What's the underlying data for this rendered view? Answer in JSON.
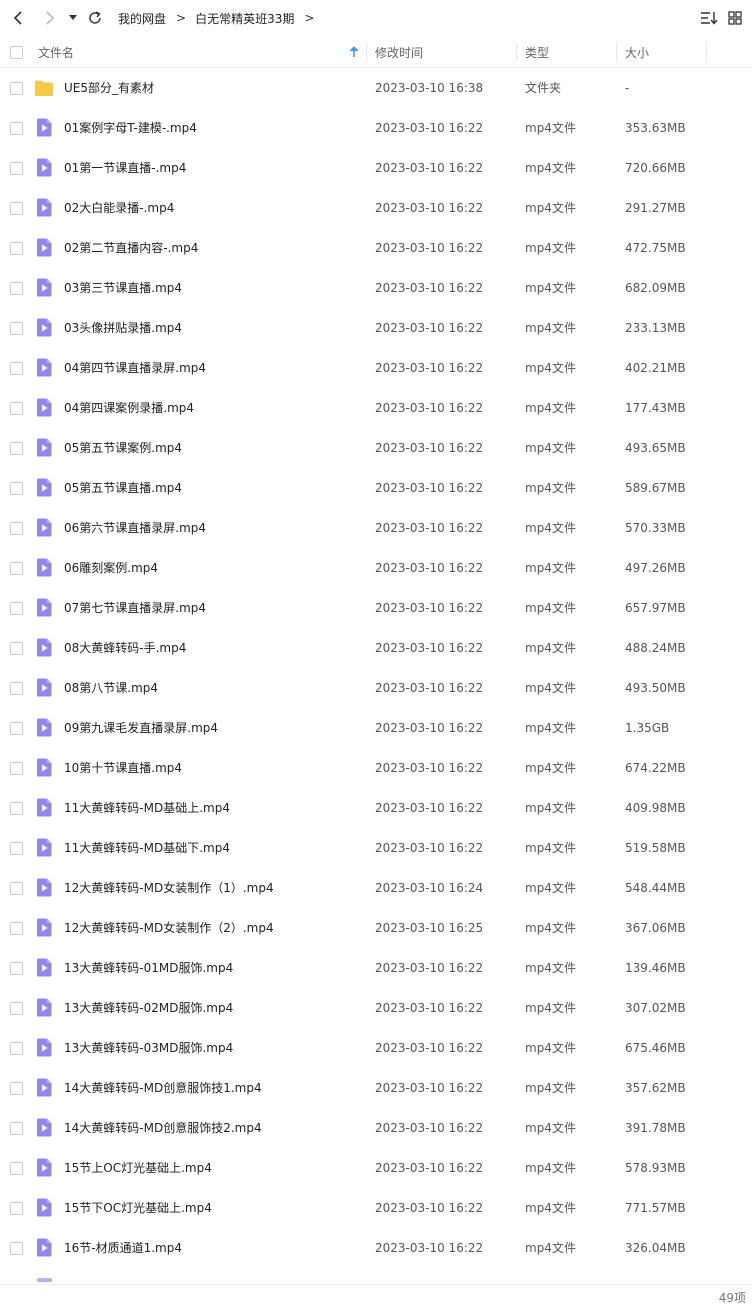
{
  "toolbar": {
    "back_icon": "chevron-left-icon",
    "forward_icon": "chevron-right-icon",
    "history_icon": "caret-down-icon",
    "refresh_icon": "refresh-icon",
    "breadcrumb": [
      "我的网盘",
      "白无常精英班33期"
    ],
    "separator": ">",
    "sort_icon": "sort-list-icon",
    "view_icon": "grid-view-icon"
  },
  "header": {
    "name": "文件名",
    "modified": "修改时间",
    "type": "类型",
    "size": "大小",
    "sort_icon": "arrow-up-icon"
  },
  "colors": {
    "folder": "#f7c948",
    "video": "#8f86ef",
    "sort_arrow": "#3a9ce8"
  },
  "files": [
    {
      "name": "UE5部分_有素材",
      "time": "2023-03-10 16:38",
      "type": "文件夹",
      "size": "-",
      "icon": "folder-icon"
    },
    {
      "name": "01案例字母T-建模-.mp4",
      "time": "2023-03-10 16:22",
      "type": "mp4文件",
      "size": "353.63MB",
      "icon": "video-file-icon"
    },
    {
      "name": "01第一节课直播-.mp4",
      "time": "2023-03-10 16:22",
      "type": "mp4文件",
      "size": "720.66MB",
      "icon": "video-file-icon"
    },
    {
      "name": "02大白能录播-.mp4",
      "time": "2023-03-10 16:22",
      "type": "mp4文件",
      "size": "291.27MB",
      "icon": "video-file-icon"
    },
    {
      "name": "02第二节直播内容-.mp4",
      "time": "2023-03-10 16:22",
      "type": "mp4文件",
      "size": "472.75MB",
      "icon": "video-file-icon"
    },
    {
      "name": "03第三节课直播.mp4",
      "time": "2023-03-10 16:22",
      "type": "mp4文件",
      "size": "682.09MB",
      "icon": "video-file-icon"
    },
    {
      "name": "03头像拼贴录播.mp4",
      "time": "2023-03-10 16:22",
      "type": "mp4文件",
      "size": "233.13MB",
      "icon": "video-file-icon"
    },
    {
      "name": "04第四节课直播录屏.mp4",
      "time": "2023-03-10 16:22",
      "type": "mp4文件",
      "size": "402.21MB",
      "icon": "video-file-icon"
    },
    {
      "name": "04第四课案例录播.mp4",
      "time": "2023-03-10 16:22",
      "type": "mp4文件",
      "size": "177.43MB",
      "icon": "video-file-icon"
    },
    {
      "name": "05第五节课案例.mp4",
      "time": "2023-03-10 16:22",
      "type": "mp4文件",
      "size": "493.65MB",
      "icon": "video-file-icon"
    },
    {
      "name": "05第五节课直播.mp4",
      "time": "2023-03-10 16:22",
      "type": "mp4文件",
      "size": "589.67MB",
      "icon": "video-file-icon"
    },
    {
      "name": "06第六节课直播录屏.mp4",
      "time": "2023-03-10 16:22",
      "type": "mp4文件",
      "size": "570.33MB",
      "icon": "video-file-icon"
    },
    {
      "name": "06雕刻案例.mp4",
      "time": "2023-03-10 16:22",
      "type": "mp4文件",
      "size": "497.26MB",
      "icon": "video-file-icon"
    },
    {
      "name": "07第七节课直播录屏.mp4",
      "time": "2023-03-10 16:22",
      "type": "mp4文件",
      "size": "657.97MB",
      "icon": "video-file-icon"
    },
    {
      "name": "08大黄蜂转码-手.mp4",
      "time": "2023-03-10 16:22",
      "type": "mp4文件",
      "size": "488.24MB",
      "icon": "video-file-icon"
    },
    {
      "name": "08第八节课.mp4",
      "time": "2023-03-10 16:22",
      "type": "mp4文件",
      "size": "493.50MB",
      "icon": "video-file-icon"
    },
    {
      "name": "09第九课毛发直播录屏.mp4",
      "time": "2023-03-10 16:22",
      "type": "mp4文件",
      "size": "1.35GB",
      "icon": "video-file-icon"
    },
    {
      "name": "10第十节课直播.mp4",
      "time": "2023-03-10 16:22",
      "type": "mp4文件",
      "size": "674.22MB",
      "icon": "video-file-icon"
    },
    {
      "name": "11大黄蜂转码-MD基础上.mp4",
      "time": "2023-03-10 16:22",
      "type": "mp4文件",
      "size": "409.98MB",
      "icon": "video-file-icon"
    },
    {
      "name": "11大黄蜂转码-MD基础下.mp4",
      "time": "2023-03-10 16:22",
      "type": "mp4文件",
      "size": "519.58MB",
      "icon": "video-file-icon"
    },
    {
      "name": "12大黄蜂转码-MD女装制作（1）.mp4",
      "time": "2023-03-10 16:24",
      "type": "mp4文件",
      "size": "548.44MB",
      "icon": "video-file-icon"
    },
    {
      "name": "12大黄蜂转码-MD女装制作（2）.mp4",
      "time": "2023-03-10 16:25",
      "type": "mp4文件",
      "size": "367.06MB",
      "icon": "video-file-icon"
    },
    {
      "name": "13大黄蜂转码-01MD服饰.mp4",
      "time": "2023-03-10 16:22",
      "type": "mp4文件",
      "size": "139.46MB",
      "icon": "video-file-icon"
    },
    {
      "name": "13大黄蜂转码-02MD服饰.mp4",
      "time": "2023-03-10 16:22",
      "type": "mp4文件",
      "size": "307.02MB",
      "icon": "video-file-icon"
    },
    {
      "name": "13大黄蜂转码-03MD服饰.mp4",
      "time": "2023-03-10 16:22",
      "type": "mp4文件",
      "size": "675.46MB",
      "icon": "video-file-icon"
    },
    {
      "name": "14大黄蜂转码-MD创意服饰技1.mp4",
      "time": "2023-03-10 16:22",
      "type": "mp4文件",
      "size": "357.62MB",
      "icon": "video-file-icon"
    },
    {
      "name": "14大黄蜂转码-MD创意服饰技2.mp4",
      "time": "2023-03-10 16:22",
      "type": "mp4文件",
      "size": "391.78MB",
      "icon": "video-file-icon"
    },
    {
      "name": "15节上OC灯光基础上.mp4",
      "time": "2023-03-10 16:22",
      "type": "mp4文件",
      "size": "578.93MB",
      "icon": "video-file-icon"
    },
    {
      "name": "15节下OC灯光基础上.mp4",
      "time": "2023-03-10 16:22",
      "type": "mp4文件",
      "size": "771.57MB",
      "icon": "video-file-icon"
    },
    {
      "name": "16节-材质通道1.mp4",
      "time": "2023-03-10 16:22",
      "type": "mp4文件",
      "size": "326.04MB",
      "icon": "video-file-icon"
    }
  ],
  "footer": {
    "item_count": "49项"
  }
}
